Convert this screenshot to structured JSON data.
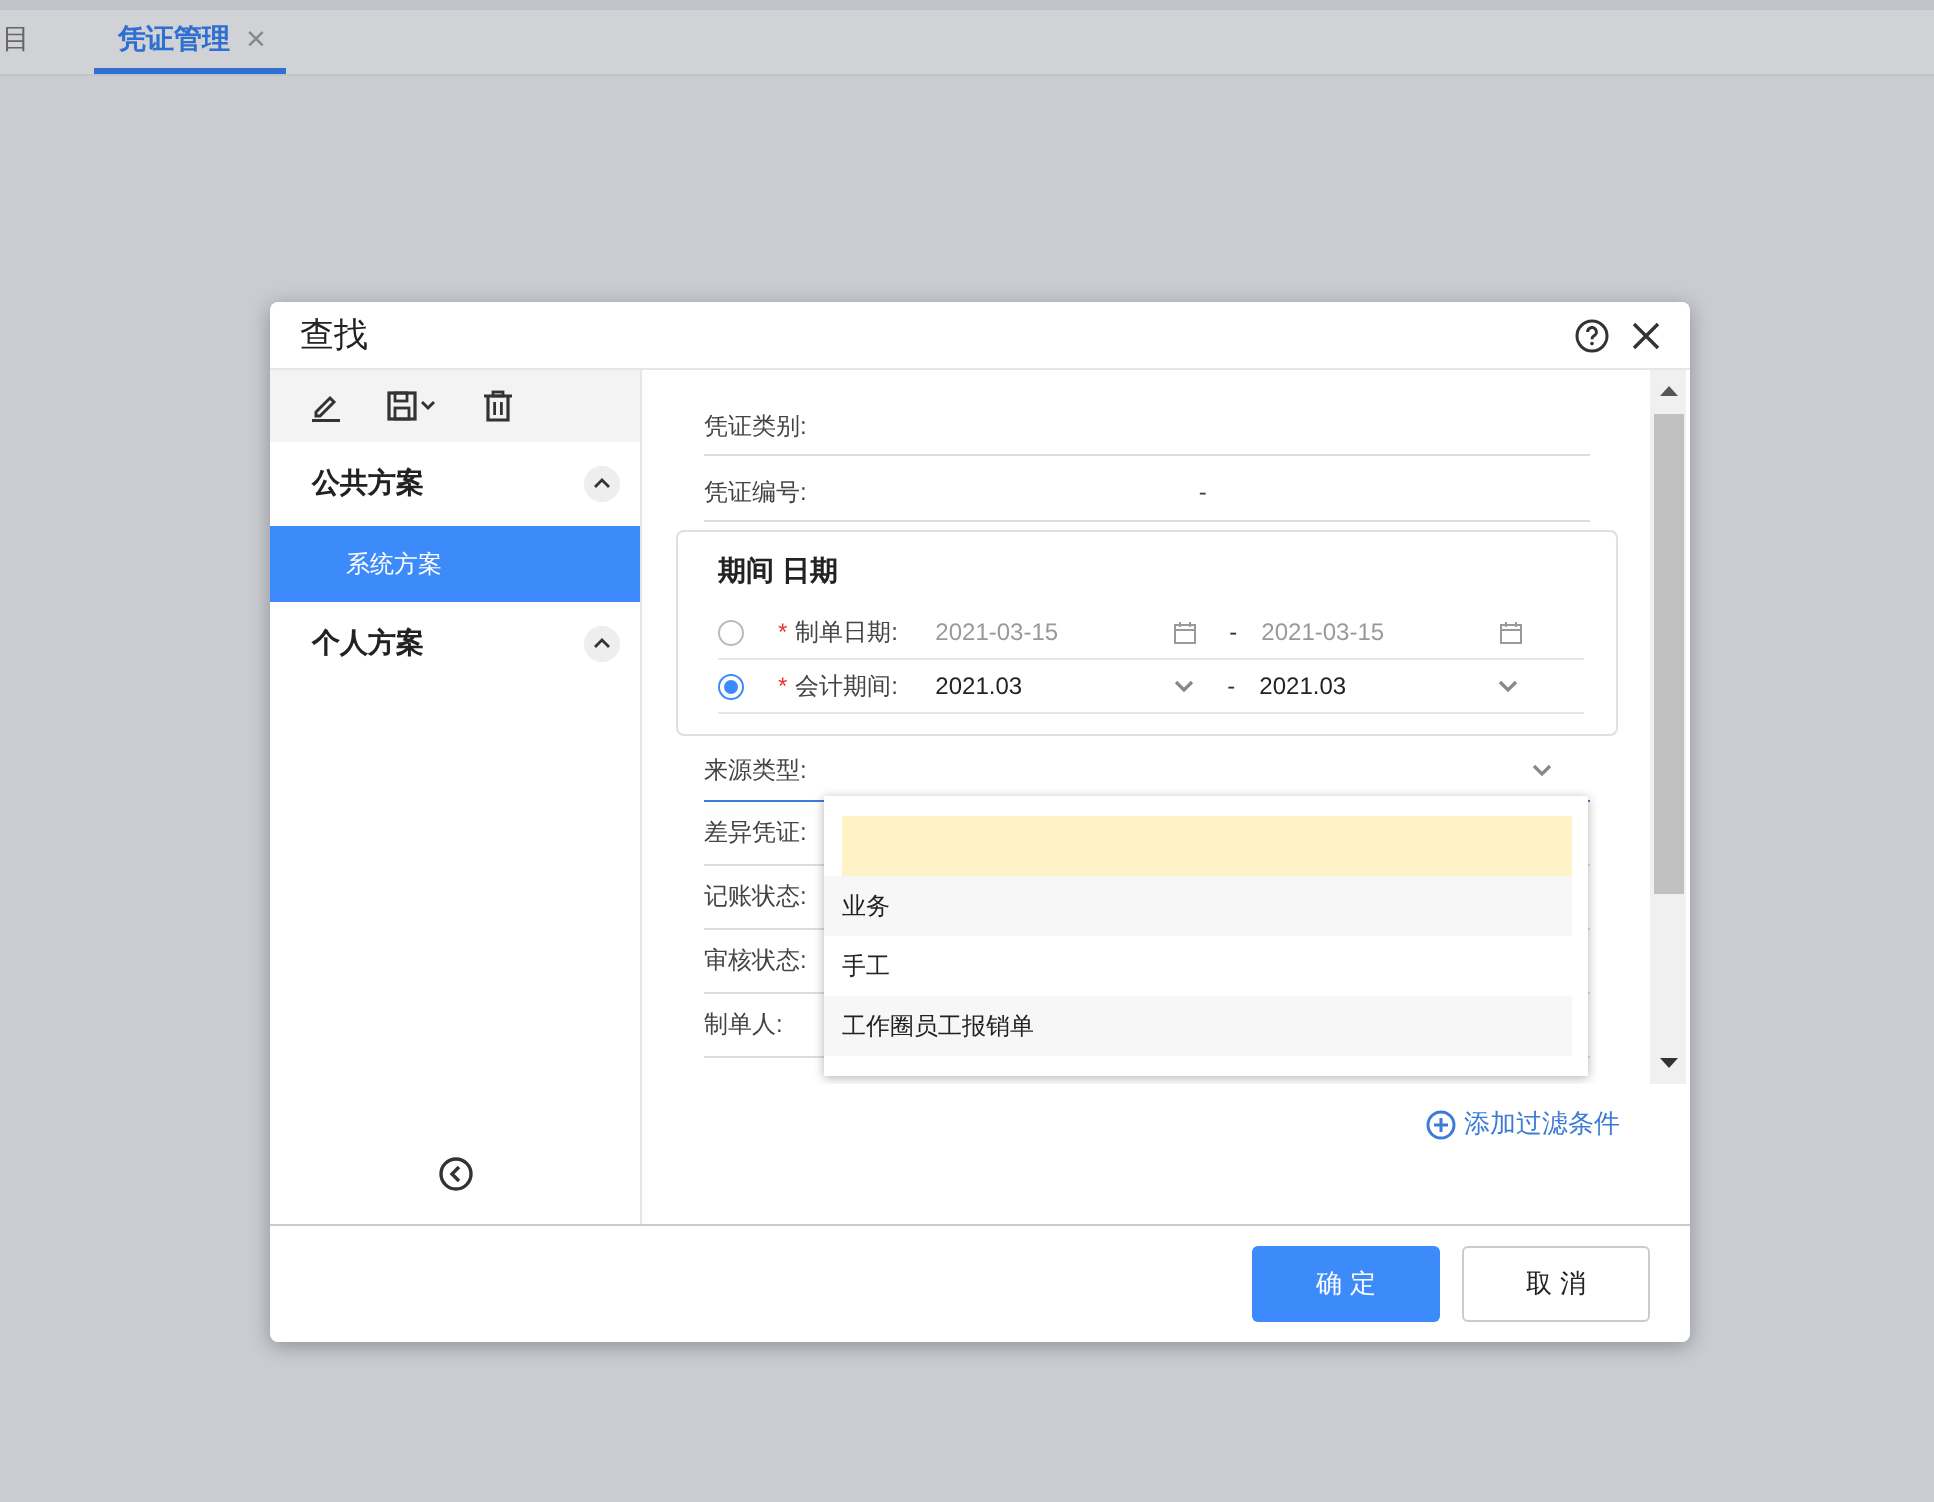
{
  "top_bar": {
    "menu_fragment": "目",
    "tabs": [
      {
        "label": "凭证管理",
        "selected": true,
        "close": "×"
      }
    ]
  },
  "dialog": {
    "title": "查找",
    "sidebar": {
      "groups": [
        {
          "label": "公共方案",
          "expanded": true,
          "items": [
            {
              "label": "系统方案",
              "selected": true
            }
          ]
        },
        {
          "label": "个人方案",
          "expanded": true
        }
      ]
    },
    "fields": [
      {
        "kind": "line",
        "label": "凭证类别:"
      },
      {
        "kind": "range",
        "label": "凭证编号:",
        "separator": "-"
      }
    ],
    "period_box": {
      "title": "期间 日期",
      "options": [
        {
          "kind": "date",
          "label": "制单日期:",
          "required_mark": "*",
          "selected": false,
          "from": "2021-03-15",
          "separator": "-",
          "to": "2021-03-15"
        },
        {
          "kind": "period",
          "label": "会计期间:",
          "required_mark": "*",
          "selected": true,
          "from": "2021.03",
          "separator": "-",
          "to": "2021.03"
        }
      ]
    },
    "source_type": {
      "label": "来源类型:",
      "open": true,
      "options": [
        {
          "selected": true
        },
        {
          "label": "业务",
          "selected": false
        },
        {
          "label": "手工",
          "selected": false
        },
        {
          "label": "工作圈员工报销单",
          "selected": false
        }
      ]
    },
    "more_fields": [
      "差异凭证:",
      "记账状态:",
      "审核状态:",
      "制单人:"
    ],
    "add_filter": "添加过滤条件",
    "buttons": [
      {
        "label": "确 定",
        "kind": "primary"
      },
      {
        "label": "取 消",
        "kind": "default"
      }
    ]
  }
}
